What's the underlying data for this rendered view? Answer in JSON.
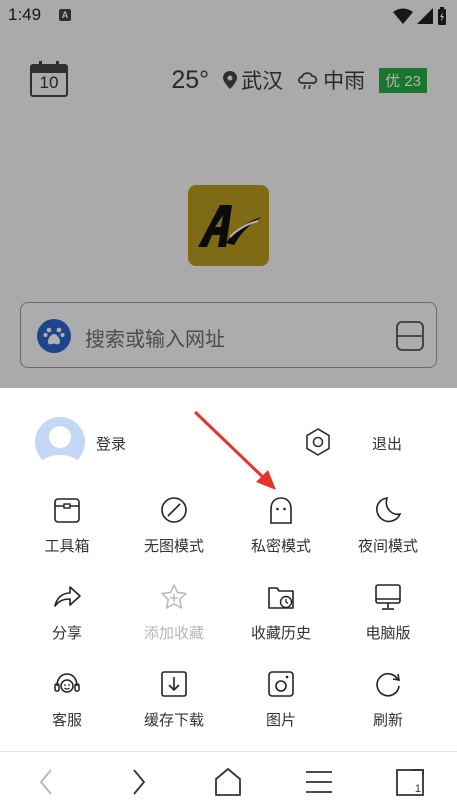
{
  "status_bar": {
    "time": "1:49",
    "notification": "A"
  },
  "home": {
    "calendar_day": "10",
    "temperature": "25°",
    "city": "武汉",
    "weather": "中雨",
    "aqi": "优 23",
    "search_placeholder": "搜索或输入网址"
  },
  "menu": {
    "login_label": "登录",
    "logout_label": "退出",
    "items": [
      {
        "label": "工具箱",
        "icon": "toolbox-icon",
        "enabled": true
      },
      {
        "label": "无图模式",
        "icon": "no-image-icon",
        "enabled": true
      },
      {
        "label": "私密模式",
        "icon": "ghost-icon",
        "enabled": true
      },
      {
        "label": "夜间模式",
        "icon": "moon-icon",
        "enabled": true
      },
      {
        "label": "分享",
        "icon": "share-icon",
        "enabled": true
      },
      {
        "label": "添加收藏",
        "icon": "star-add-icon",
        "enabled": false
      },
      {
        "label": "收藏历史",
        "icon": "folder-history-icon",
        "enabled": true
      },
      {
        "label": "电脑版",
        "icon": "desktop-icon",
        "enabled": true
      },
      {
        "label": "客服",
        "icon": "headset-icon",
        "enabled": true
      },
      {
        "label": "缓存下载",
        "icon": "download-icon",
        "enabled": true
      },
      {
        "label": "图片",
        "icon": "image-icon",
        "enabled": true
      },
      {
        "label": "刷新",
        "icon": "refresh-icon",
        "enabled": true
      }
    ]
  },
  "navbar": {
    "tab_count": "1"
  },
  "colors": {
    "aqi": "#23a943",
    "logo": "#b69a1f",
    "baidu": "#2b63c8",
    "arrow": "#e8332a"
  }
}
